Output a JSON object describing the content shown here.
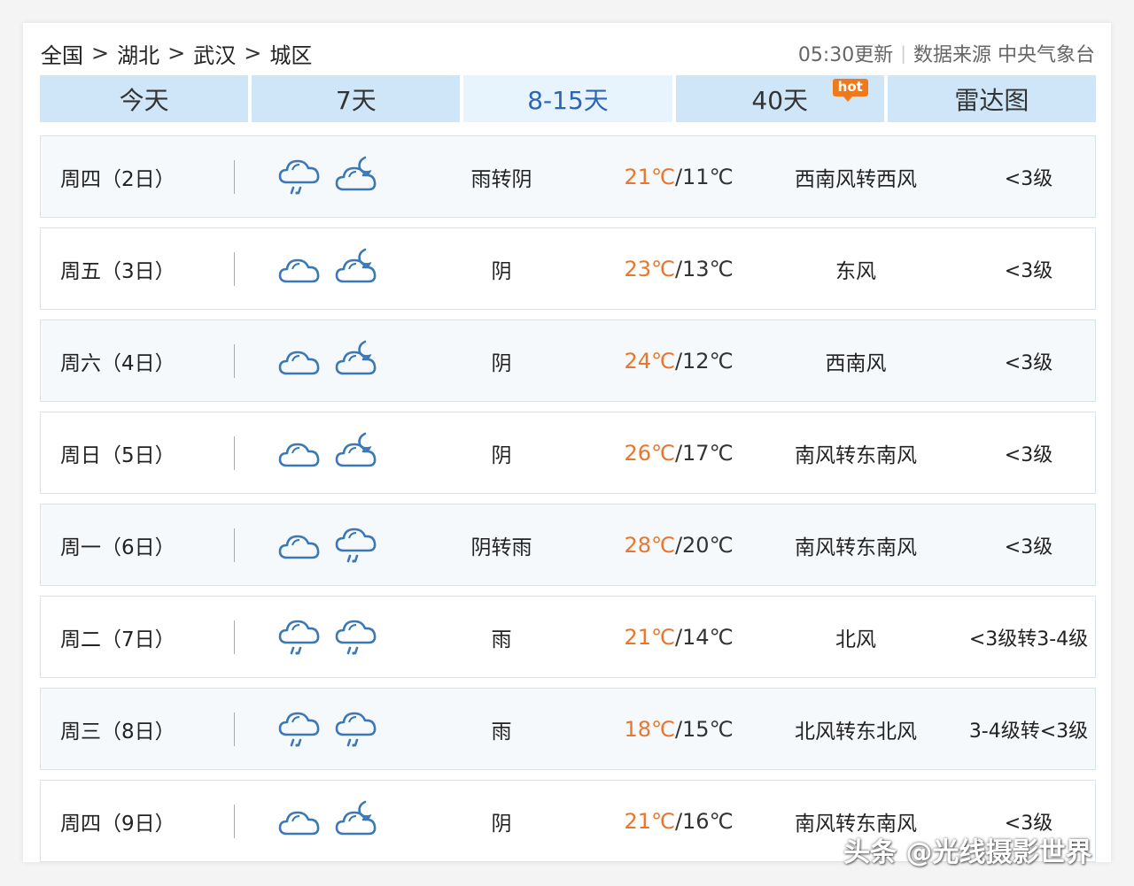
{
  "breadcrumb": [
    "全国",
    "湖北",
    "武汉",
    "城区"
  ],
  "breadcrumb_sep": ">",
  "update_time": "05:30更新",
  "source": "数据来源 中央气象台",
  "tabs": [
    {
      "label": "今天"
    },
    {
      "label": "7天"
    },
    {
      "label": "8-15天",
      "active": true
    },
    {
      "label": "40天",
      "badge": "hot"
    },
    {
      "label": "雷达图"
    }
  ],
  "days": [
    {
      "day": "周四（2日）",
      "icons": [
        "rain-cloud",
        "cloud-moon"
      ],
      "desc": "雨转阴",
      "high": "21℃",
      "low": "/11℃",
      "wind": "西南风转西风",
      "level": "<3级"
    },
    {
      "day": "周五（3日）",
      "icons": [
        "cloud",
        "cloud-moon"
      ],
      "desc": "阴",
      "high": "23℃",
      "low": "/13℃",
      "wind": "东风",
      "level": "<3级"
    },
    {
      "day": "周六（4日）",
      "icons": [
        "cloud",
        "cloud-moon"
      ],
      "desc": "阴",
      "high": "24℃",
      "low": "/12℃",
      "wind": "西南风",
      "level": "<3级"
    },
    {
      "day": "周日（5日）",
      "icons": [
        "cloud",
        "cloud-moon"
      ],
      "desc": "阴",
      "high": "26℃",
      "low": "/17℃",
      "wind": "南风转东南风",
      "level": "<3级"
    },
    {
      "day": "周一（6日）",
      "icons": [
        "cloud",
        "rain-cloud"
      ],
      "desc": "阴转雨",
      "high": "28℃",
      "low": "/20℃",
      "wind": "南风转东南风",
      "level": "<3级"
    },
    {
      "day": "周二（7日）",
      "icons": [
        "rain-cloud",
        "rain-cloud"
      ],
      "desc": "雨",
      "high": "21℃",
      "low": "/14℃",
      "wind": "北风",
      "level": "<3级转3-4级"
    },
    {
      "day": "周三（8日）",
      "icons": [
        "rain-cloud",
        "rain-cloud"
      ],
      "desc": "雨",
      "high": "18℃",
      "low": "/15℃",
      "wind": "北风转东北风",
      "level": "3-4级转<3级"
    },
    {
      "day": "周四（9日）",
      "icons": [
        "cloud",
        "cloud-moon"
      ],
      "desc": "阴",
      "high": "21℃",
      "low": "/16℃",
      "wind": "南风转东南风",
      "level": "<3级"
    }
  ],
  "watermark": "头条 @光线摄影世界",
  "colors": {
    "accent": "#2a66b8",
    "tab_bg": "#cfe6f8",
    "high_temp": "#e8762c",
    "icon": "#3a78b8"
  }
}
